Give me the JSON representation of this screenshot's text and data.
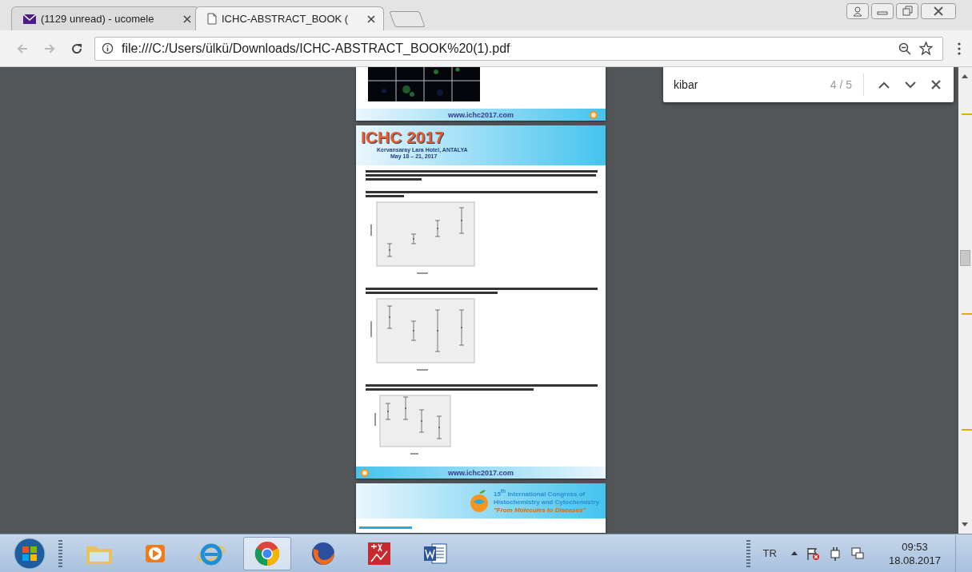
{
  "tabs": [
    {
      "kind": "mail",
      "title": "(1129 unread) - ucomele",
      "selected": false
    },
    {
      "kind": "document",
      "title": "ICHC-ABSTRACT_BOOK (",
      "selected": true
    }
  ],
  "address_bar": {
    "url": "file:///C:/Users/ülkü/Downloads/ICHC-ABSTRACT_BOOK%20(1).pdf"
  },
  "find_bar": {
    "query": "kibar",
    "count": "4 / 5"
  },
  "pdf": {
    "page_top": {
      "footer_url": "www.ichc2017.com"
    },
    "page_middle": {
      "header_title": "ICHC 2017",
      "venue": "Kervansaray Lara Hotel, ANTALYA",
      "dates": "May 18 – 21, 2017",
      "footer_url": "www.ichc2017.com"
    },
    "page_bottom": {
      "congress_lines": [
        "15$^{th}$ International Congress of",
        "Histochemistry and Cytochemistry"
      ],
      "motto": "\"From Molecules to Diseases\""
    }
  },
  "taskbar": {
    "apps": [
      {
        "kind": "explorer",
        "selected": false
      },
      {
        "kind": "media",
        "selected": false
      },
      {
        "kind": "ie",
        "selected": false
      },
      {
        "kind": "chrome",
        "selected": true
      },
      {
        "kind": "firefox",
        "selected": false
      },
      {
        "kind": "math",
        "selected": false
      },
      {
        "kind": "word",
        "selected": false
      }
    ],
    "language": "TR",
    "time": "09:53",
    "date": "18.08.2017"
  }
}
